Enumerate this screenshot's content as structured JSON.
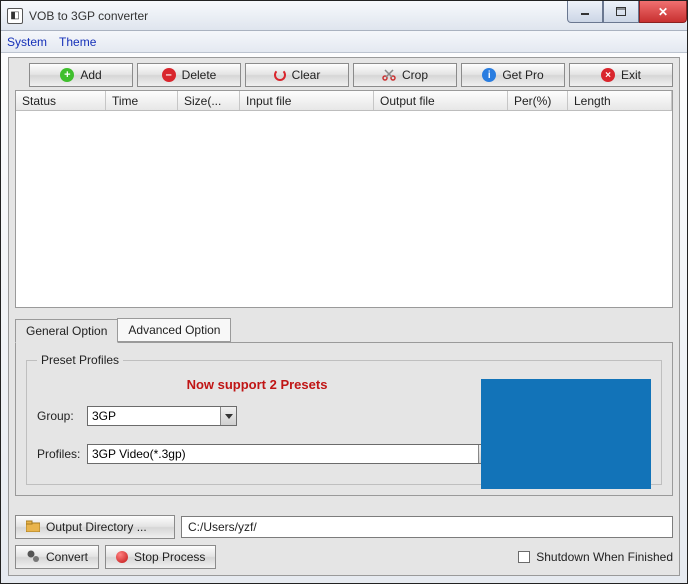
{
  "window": {
    "title": "VOB to 3GP converter"
  },
  "menus": {
    "system": "System",
    "theme": "Theme"
  },
  "toolbar": {
    "add": "Add",
    "delete": "Delete",
    "clear": "Clear",
    "crop": "Crop",
    "getpro": "Get Pro",
    "exit": "Exit"
  },
  "columns": {
    "status": "Status",
    "time": "Time",
    "size": "Size(...",
    "input": "Input file",
    "output": "Output file",
    "per": "Per(%)",
    "length": "Length"
  },
  "tabs": {
    "general": "General Option",
    "advanced": "Advanced Option"
  },
  "preset": {
    "legend": "Preset Profiles",
    "message": "Now support 2 Presets",
    "group_label": "Group:",
    "group_value": "3GP",
    "profiles_label": "Profiles:",
    "profiles_value": "3GP Video(*.3gp)"
  },
  "output": {
    "button": "Output Directory ...",
    "path": "C:/Users/yzf/"
  },
  "actions": {
    "convert": "Convert",
    "stop": "Stop Process",
    "shutdown": "Shutdown When Finished"
  }
}
